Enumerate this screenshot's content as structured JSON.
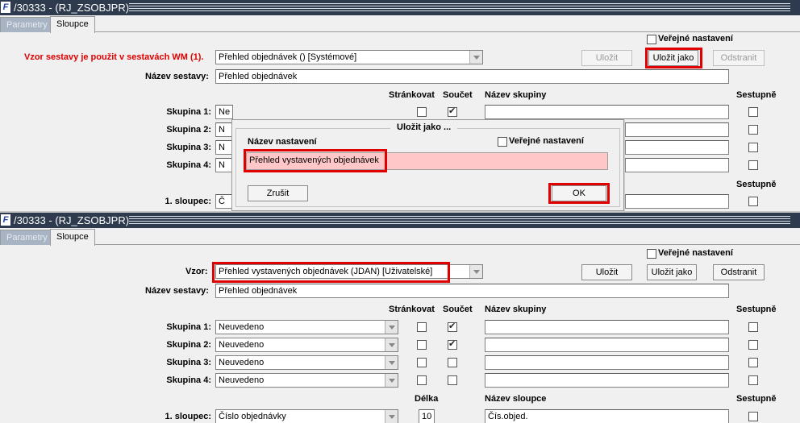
{
  "top": {
    "title": "/30333 - (RJ_ZSOBJPR)",
    "tabs": [
      "Parametry",
      "Sloupce"
    ],
    "public_settings": "Veřejné nastavení",
    "vzor_warning": "Vzor sestavy je použit v sestavách WM (1).",
    "vzor_value": "Přehled objednávek   ()   [Systémové]",
    "btn_save": "Uložit",
    "btn_save_as": "Uložit jako",
    "btn_remove": "Odstranit",
    "nazev_sestavy_label": "Název sestavy:",
    "nazev_sestavy_value": "Přehled objednávek",
    "col_strankovat": "Stránkovat",
    "col_soucet": "Součet",
    "col_nazev_skupiny": "Název skupiny",
    "col_sestupne": "Sestupně",
    "groups": [
      {
        "label": "Skupina 1:",
        "value": "Ne"
      },
      {
        "label": "Skupina 2:",
        "value": "N"
      },
      {
        "label": "Skupina 3:",
        "value": "N"
      },
      {
        "label": "Skupina 4:",
        "value": "N"
      }
    ],
    "sestupne2": "Sestupně",
    "sloupec_label": "1. sloupec:",
    "sloupec_value": "Č"
  },
  "dialog": {
    "title": "Uložit jako ...",
    "name_label": "Název nastavení",
    "public_label": "Veřejné nastavení",
    "name_value": "Přehled vystavených objednávek",
    "cancel": "Zrušit",
    "ok": "OK"
  },
  "bottom": {
    "title": "/30333 - (RJ_ZSOBJPR)",
    "tabs": [
      "Parametry",
      "Sloupce"
    ],
    "public_settings": "Veřejné nastavení",
    "vzor_label": "Vzor:",
    "vzor_value": "Přehled vystavených objednávek   (JDAN)   [Uživatelské]",
    "btn_save": "Uložit",
    "btn_save_as": "Uložit jako",
    "btn_remove": "Odstranit",
    "nazev_sestavy_label": "Název sestavy:",
    "nazev_sestavy_value": "Přehled objednávek",
    "col_strankovat": "Stránkovat",
    "col_soucet": "Součet",
    "col_nazev_skupiny": "Název skupiny",
    "col_sestupne": "Sestupně",
    "groups": [
      {
        "label": "Skupina 1:",
        "value": "Neuvedeno",
        "strankovat": false,
        "soucet": true,
        "sestupne": false
      },
      {
        "label": "Skupina 2:",
        "value": "Neuvedeno",
        "strankovat": false,
        "soucet": true,
        "sestupne": false
      },
      {
        "label": "Skupina 3:",
        "value": "Neuvedeno",
        "strankovat": false,
        "soucet": false,
        "sestupne": false
      },
      {
        "label": "Skupina 4:",
        "value": "Neuvedeno",
        "strankovat": false,
        "soucet": false,
        "sestupne": false
      }
    ],
    "col_delka": "Délka",
    "col_nazev_sloupce": "Název sloupce",
    "col_sestupne2": "Sestupně",
    "sloupec_label": "1. sloupec:",
    "sloupec_value": "Číslo objednávky",
    "sloupec_delka": "10",
    "sloupec_nazev": "Čís.objed."
  }
}
